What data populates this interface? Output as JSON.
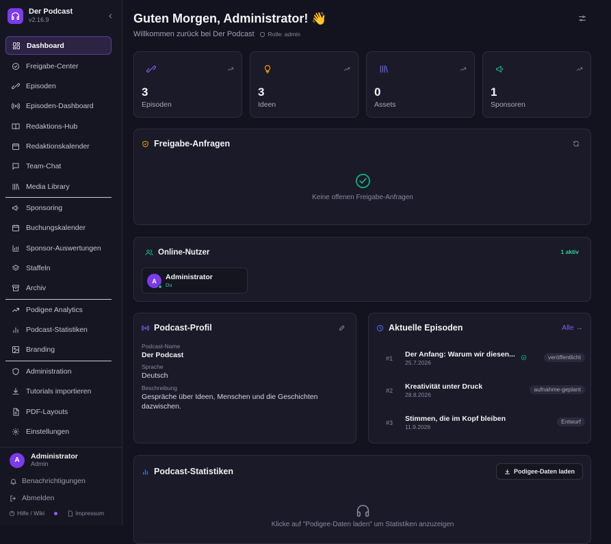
{
  "app": {
    "name": "Der Podcast",
    "version": "v2.16.9"
  },
  "sidebar": {
    "items": [
      {
        "label": "Dashboard",
        "icon": "dashboard-icon"
      },
      {
        "label": "Freigabe-Center",
        "icon": "check-circle-icon"
      },
      {
        "label": "Episoden",
        "icon": "link-icon"
      },
      {
        "label": "Episoden-Dashboard",
        "icon": "broadcast-icon"
      },
      {
        "label": "Redaktions-Hub",
        "icon": "book-icon"
      },
      {
        "label": "Redaktionskalender",
        "icon": "calendar-icon"
      },
      {
        "label": "Team-Chat",
        "icon": "chat-icon"
      },
      {
        "label": "Media Library",
        "icon": "library-icon"
      },
      {
        "label": "Sponsoring",
        "icon": "megaphone-icon"
      },
      {
        "label": "Buchungskalender",
        "icon": "calendar-icon"
      },
      {
        "label": "Sponsor-Auswertungen",
        "icon": "bar-chart-icon"
      },
      {
        "label": "Staffeln",
        "icon": "layers-icon"
      },
      {
        "label": "Archiv",
        "icon": "archive-icon"
      },
      {
        "label": "Podigee Analytics",
        "icon": "trend-icon"
      },
      {
        "label": "Podcast-Statistiken",
        "icon": "stats-icon"
      },
      {
        "label": "Branding",
        "icon": "image-icon"
      },
      {
        "label": "Administration",
        "icon": "shield-icon"
      },
      {
        "label": "Tutorials importieren",
        "icon": "download-icon"
      },
      {
        "label": "PDF-Layouts",
        "icon": "file-icon"
      },
      {
        "label": "Einstellungen",
        "icon": "gear-icon"
      }
    ],
    "user": {
      "initial": "A",
      "name": "Administrator",
      "role": "Admin"
    },
    "notifications": "Benachrichtigungen",
    "logout": "Abmelden",
    "help": "Hilfe / Wiki",
    "imprint": "Impressum"
  },
  "header": {
    "greeting": "Guten Morgen, Administrator! 👋",
    "welcome": "Willkommen zurück bei Der Podcast",
    "role": "Rolle: admin"
  },
  "stats": [
    {
      "value": "3",
      "label": "Episoden",
      "color": "#8b5cf6",
      "icon": "link-icon"
    },
    {
      "value": "3",
      "label": "Ideen",
      "color": "#f59e0b",
      "icon": "lightbulb-icon"
    },
    {
      "value": "0",
      "label": "Assets",
      "color": "#6366f1",
      "icon": "library-icon"
    },
    {
      "value": "1",
      "label": "Sponsoren",
      "color": "#10b981",
      "icon": "megaphone-icon"
    }
  ],
  "approvals": {
    "title": "Freigabe-Anfragen",
    "empty": "Keine offenen Freigabe-Anfragen"
  },
  "online": {
    "title": "Online-Nutzer",
    "count": "1 aktiv",
    "user": {
      "initial": "A",
      "name": "Administrator",
      "sub": "Du"
    }
  },
  "profile": {
    "title": "Podcast-Profil",
    "name_label": "Podcast-Name",
    "name": "Der Podcast",
    "lang_label": "Sprache",
    "lang": "Deutsch",
    "desc_label": "Beschreibung",
    "desc": "Gespräche über Ideen, Menschen und die Geschichten dazwischen."
  },
  "episodes": {
    "title": "Aktuelle Episoden",
    "all": "Alle →",
    "items": [
      {
        "num": "#1",
        "title": "Der Anfang: Warum wir diesen...",
        "date": "25.7.2026",
        "status": "veröffentlicht"
      },
      {
        "num": "#2",
        "title": "Kreativität unter Druck",
        "date": "28.8.2026",
        "status": "aufnahme-geplant"
      },
      {
        "num": "#3",
        "title": "Stimmen, die im Kopf bleiben",
        "date": "11.9.2026",
        "status": "Entwurf"
      }
    ]
  },
  "podcast_stats": {
    "title": "Podcast-Statistiken",
    "button": "Podigee-Daten laden",
    "hint": "Klicke auf \"Podigee-Daten laden\" um Statistiken anzuzeigen"
  },
  "colors": {
    "accent": "#7c3aed",
    "success": "#10b981",
    "bg": "#13131f",
    "card": "#1a1a28"
  }
}
